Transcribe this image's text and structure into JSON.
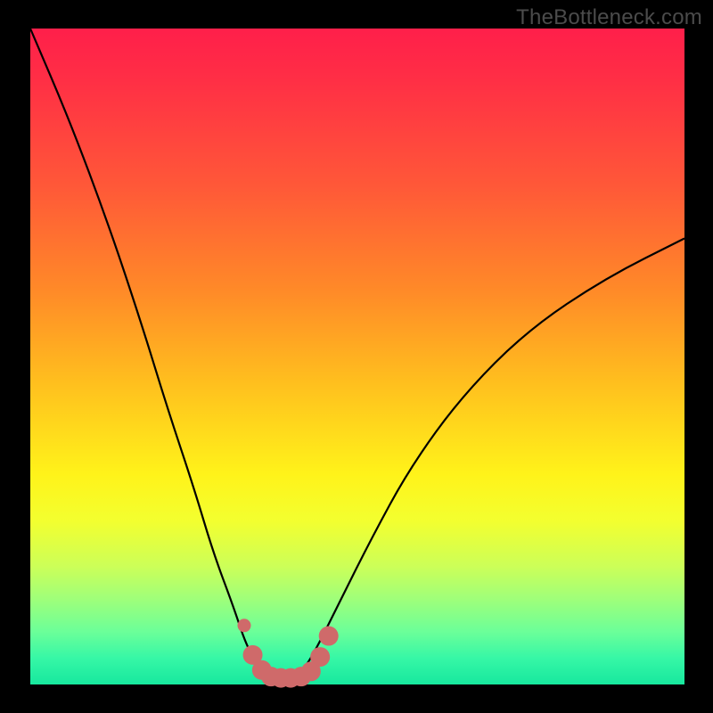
{
  "watermark": "TheBottleneck.com",
  "chart_data": {
    "type": "line",
    "title": "",
    "xlabel": "",
    "ylabel": "",
    "xlim": [
      0,
      100
    ],
    "ylim": [
      0,
      100
    ],
    "grid": false,
    "legend": false,
    "series": [
      {
        "name": "bottleneck-curve",
        "x": [
          0,
          6,
          12,
          17,
          21,
          25,
          28,
          31,
          33,
          35,
          36.5,
          38,
          40,
          42,
          44,
          47,
          52,
          58,
          66,
          76,
          88,
          100
        ],
        "y": [
          100,
          86,
          70,
          55,
          42,
          30,
          20,
          12,
          6,
          2.5,
          1,
          1,
          1,
          2.5,
          6,
          12,
          22,
          33,
          44,
          54,
          62,
          68
        ],
        "color": "#000000"
      }
    ],
    "markers": {
      "name": "highlight-band",
      "color": "#cf6a6a",
      "points": [
        {
          "x": 32.7,
          "y": 9.0
        },
        {
          "x": 34.0,
          "y": 4.5
        },
        {
          "x": 35.4,
          "y": 2.2
        },
        {
          "x": 36.8,
          "y": 1.2
        },
        {
          "x": 38.3,
          "y": 1.0
        },
        {
          "x": 39.8,
          "y": 1.0
        },
        {
          "x": 41.4,
          "y": 1.2
        },
        {
          "x": 42.9,
          "y": 2.0
        },
        {
          "x": 44.3,
          "y": 4.2
        },
        {
          "x": 45.6,
          "y": 7.4
        }
      ]
    }
  },
  "colors": {
    "gradient_top": "#ff1f4a",
    "gradient_mid": "#fff31a",
    "gradient_bottom": "#17e89e",
    "curve": "#000000",
    "marker": "#cf6a6a",
    "frame": "#000000",
    "watermark": "#4b4b4b"
  }
}
